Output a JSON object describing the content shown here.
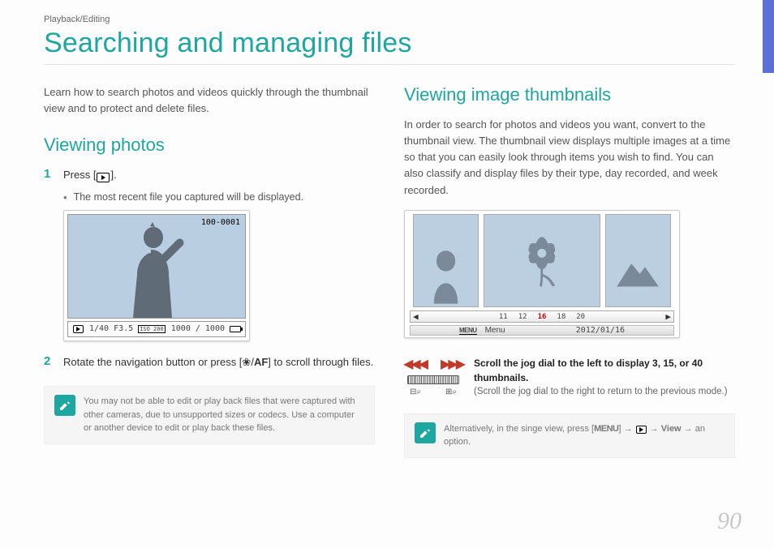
{
  "breadcrumb": "Playback/Editing",
  "title": "Searching and managing files",
  "page_number": "90",
  "left": {
    "intro": "Learn how to search photos and videos quickly through the thumbnail view and to protect and delete files.",
    "h2": "Viewing photos",
    "step1_num": "1",
    "step1_a": "Press [",
    "step1_b": "].",
    "bullet1": "The most recent file you captured will be displayed.",
    "step2_num": "2",
    "step2_a": "Rotate the navigation button or press [",
    "step2_mid": "/",
    "step2_b": "] to scroll through files.",
    "callout": "You may not be able to edit or play back files that were captured with other cameras, due to unsupported sizes or codecs. Use a computer or another device to edit or play back these files.",
    "cam1": {
      "file_no": "100-0001",
      "shutter": "1/40",
      "aperture": "F3.5",
      "iso": "ISO 200",
      "counter": "1000 / 1000"
    }
  },
  "right": {
    "h2": "Viewing image thumbnails",
    "intro": "In order to search for photos and videos you want, convert to the thumbnail view. The thumbnail view displays multiple images at a time so that you can easily look through items you wish to find. You can also classify and display files by their type, day recorded, and week recorded.",
    "strip_nums": [
      "11",
      "12",
      "16",
      "18",
      "20"
    ],
    "menu_label": "Menu",
    "date": "2012/01/16",
    "jog_bold": "Scroll the jog dial to the left to display 3, 15, or 40 thumbnails.",
    "jog_sub": "(Scroll the jog dial to the right to return to the previous mode.)",
    "callout_a": "Alternatively, in the singe view, press [",
    "callout_menu": "MENU",
    "callout_b": "] → ",
    "callout_c": " → ",
    "callout_view": "View",
    "callout_d": " → an option."
  }
}
